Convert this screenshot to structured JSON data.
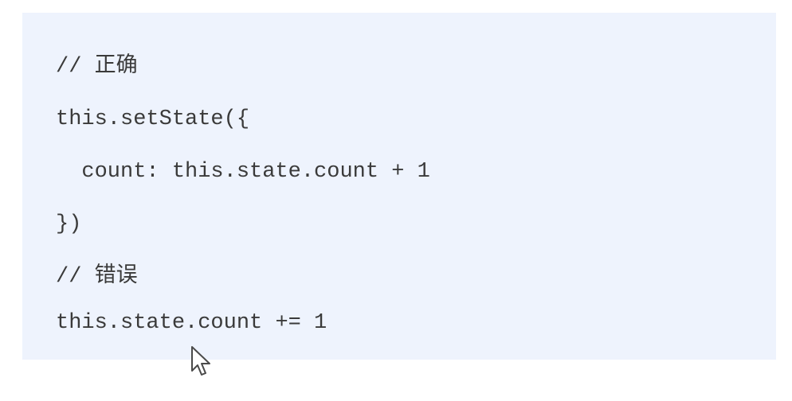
{
  "code": {
    "lines": [
      "// 正确",
      "this.setState({",
      "  count: this.state.count + 1",
      "})",
      "// 错误",
      "this.state.count += 1"
    ]
  },
  "cursor": {
    "icon": "mouse-pointer-icon"
  }
}
